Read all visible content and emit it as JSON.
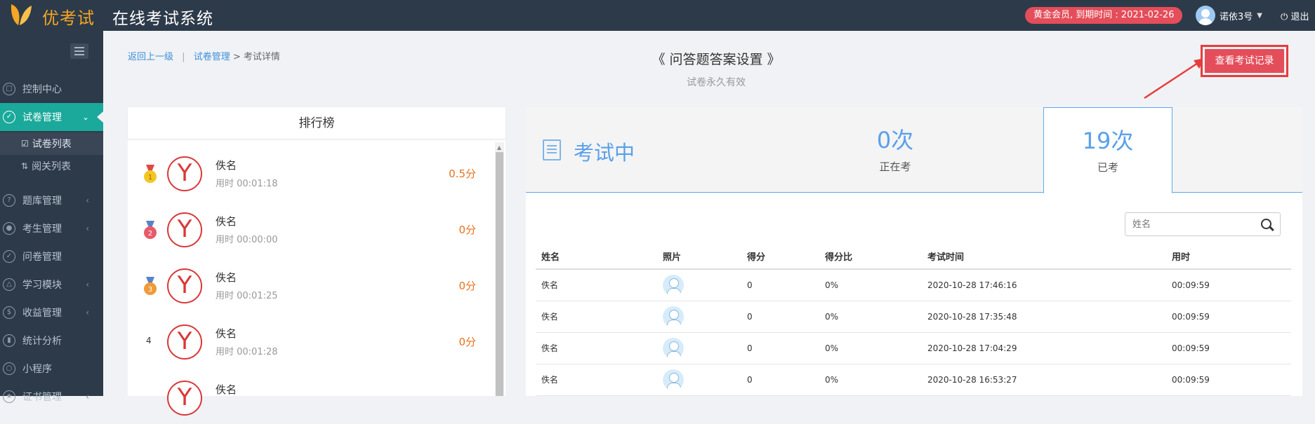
{
  "header": {
    "brand": "优考试",
    "system_title": "在线考试系统",
    "membership": "黄金会员, 到期时间 : 2021-02-26",
    "username": "诺依3号",
    "logout": "退出"
  },
  "sidebar": {
    "items": [
      {
        "label": "控制中心",
        "icon": "monitor-icon"
      },
      {
        "label": "试卷管理",
        "icon": "check-circle-icon"
      },
      {
        "label": "题库管理",
        "icon": "question-icon"
      },
      {
        "label": "考生管理",
        "icon": "user-icon"
      },
      {
        "label": "问卷管理",
        "icon": "checkbox-icon"
      },
      {
        "label": "学习模块",
        "icon": "graduation-cap-icon"
      },
      {
        "label": "收益管理",
        "icon": "money-icon"
      },
      {
        "label": "统计分析",
        "icon": "bar-chart-icon"
      },
      {
        "label": "小程序",
        "icon": "wechat-icon"
      },
      {
        "label": "证书管理",
        "icon": "certificate-icon"
      }
    ],
    "subitems": [
      {
        "label": "试卷列表",
        "icon": "check-circle-icon"
      },
      {
        "label": "阅关列表",
        "icon": "shuffle-icon"
      }
    ]
  },
  "breadcrumb": {
    "back": "返回上一级",
    "separator": "|",
    "parent": "试卷管理",
    "arrow": ">",
    "current": "考试详情"
  },
  "page": {
    "title": "《 问答题答案设置 》",
    "subtitle": "试卷永久有效",
    "record_button": "查看考试记录"
  },
  "ranking": {
    "title": "排行榜",
    "items": [
      {
        "rank": "1",
        "name": "佚名",
        "time": "用时 00:01:18",
        "score": "0.5分",
        "medal": "gold"
      },
      {
        "rank": "2",
        "name": "佚名",
        "time": "用时 00:00:00",
        "score": "0分",
        "medal": "red"
      },
      {
        "rank": "3",
        "name": "佚名",
        "time": "用时 00:01:25",
        "score": "0分",
        "medal": "bronze"
      },
      {
        "rank": "4",
        "name": "佚名",
        "time": "用时 00:01:28",
        "score": "0分",
        "medal": ""
      },
      {
        "rank": "",
        "name": "佚名",
        "time": "",
        "score": "",
        "medal": ""
      }
    ]
  },
  "exam": {
    "status": "考试中",
    "ongoing_value": "0次",
    "ongoing_label": "正在考",
    "done_value": "19次",
    "done_label": "已考",
    "search_placeholder": "姓名",
    "columns": [
      "姓名",
      "照片",
      "得分",
      "得分比",
      "考试时间",
      "用时"
    ],
    "rows": [
      {
        "name": "佚名",
        "score": "0",
        "ratio": "0%",
        "time": "2020-10-28 17:46:16",
        "duration": "00:09:59"
      },
      {
        "name": "佚名",
        "score": "0",
        "ratio": "0%",
        "time": "2020-10-28 17:35:48",
        "duration": "00:09:59"
      },
      {
        "name": "佚名",
        "score": "0",
        "ratio": "0%",
        "time": "2020-10-28 17:04:29",
        "duration": "00:09:59"
      },
      {
        "name": "佚名",
        "score": "0",
        "ratio": "0%",
        "time": "2020-10-28 16:53:27",
        "duration": "00:09:59"
      }
    ]
  },
  "colors": {
    "topbar": "#2d3a4a",
    "accent": "#1aa99a",
    "brand_orange": "#f5a623",
    "red_button": "#e44d5a",
    "blue": "#5aa0ea",
    "score_orange": "#e8711c"
  }
}
